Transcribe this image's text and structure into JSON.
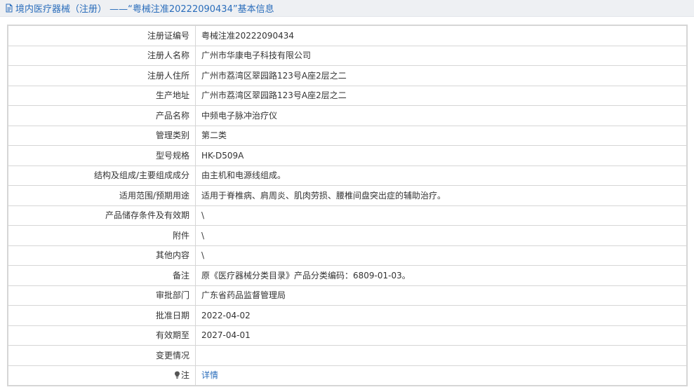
{
  "header": {
    "title": "境内医疗器械（注册） ——“粤械注准20222090434”基本信息"
  },
  "rows": [
    {
      "label": "注册证编号",
      "value": "粤械注准20222090434"
    },
    {
      "label": "注册人名称",
      "value": "广州市华康电子科技有限公司"
    },
    {
      "label": "注册人住所",
      "value": "广州市荔湾区翠园路123号A座2层之二"
    },
    {
      "label": "生产地址",
      "value": "广州市荔湾区翠园路123号A座2层之二"
    },
    {
      "label": "产品名称",
      "value": "中频电子脉冲治疗仪"
    },
    {
      "label": "管理类别",
      "value": "第二类"
    },
    {
      "label": "型号规格",
      "value": "HK-D509A"
    },
    {
      "label": "结构及组成/主要组成成分",
      "value": "由主机和电源线组成。"
    },
    {
      "label": "适用范围/预期用途",
      "value": "适用于脊椎病、肩周炎、肌肉劳损、腰椎间盘突出症的辅助治疗。"
    },
    {
      "label": "产品储存条件及有效期",
      "value": "\\"
    },
    {
      "label": "附件",
      "value": "\\"
    },
    {
      "label": "其他内容",
      "value": "\\"
    },
    {
      "label": "备注",
      "value": "原《医疗器械分类目录》产品分类编码：6809-01-03。"
    },
    {
      "label": "审批部门",
      "value": "广东省药品监督管理局"
    },
    {
      "label": "批准日期",
      "value": "2022-04-02"
    },
    {
      "label": "有效期至",
      "value": "2027-04-01"
    },
    {
      "label": "变更情况",
      "value": ""
    },
    {
      "label": "注",
      "value": "详情"
    }
  ],
  "icons": {
    "header": "document-icon",
    "note": "lightbulb-icon"
  },
  "colors": {
    "link": "#2a6dbb",
    "header_bg": "#eef0f3",
    "border": "#d6d6d6"
  }
}
